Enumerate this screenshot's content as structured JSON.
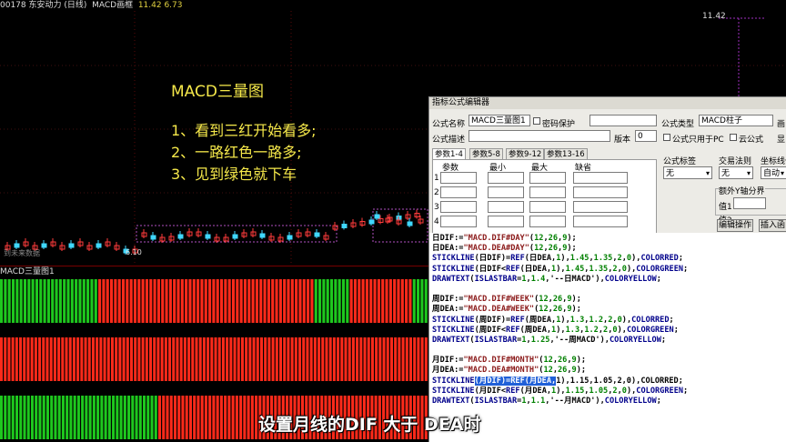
{
  "top_bar": {
    "stock": "00178 东安动力 (日线)",
    "indicator": "MACD画框",
    "values": "11.42   6.73"
  },
  "chart": {
    "high_label": "11.42",
    "low_label": "6.10",
    "bottom_left_text": "到未来数据"
  },
  "annotation": {
    "title": "MACD三量图",
    "lines": [
      "1、看到三红开始看多;",
      "2、一路红色一路多;",
      "3、见到绿色就下车"
    ]
  },
  "indicator_bar": {
    "label": "MACD三量图1"
  },
  "dialog": {
    "title": "指标公式编辑器",
    "formula_name_label": "公式名称",
    "formula_name_value": "MACD三量图1",
    "password_label": "密码保护",
    "formula_desc_label": "公式描述",
    "version_label": "版本",
    "version_value": "0",
    "formula_type_label": "公式类型",
    "formula_type_value": "MACD柱子",
    "draw_label": "画",
    "pc_only_label": "公式只用于PC",
    "cloud_label": "云公式",
    "show_label": "显",
    "tabs": [
      "参数1-4",
      "参数5-8",
      "参数9-12",
      "参数13-16"
    ],
    "param_headers": [
      "参数",
      "最小",
      "最大",
      "缺省"
    ],
    "param_rows": [
      "1",
      "2",
      "3",
      "4"
    ],
    "formula_tag_label": "公式标签",
    "formula_tag_value": "无",
    "trade_rule_label": "交易法则",
    "trade_rule_value": "无",
    "coord_label": "坐标线位",
    "coord_value": "自动",
    "extra_y_label": "额外Y轴分界",
    "value1_label": "值1",
    "value2_label": "值2",
    "edit_btn": "编辑操作",
    "insert_btn": "插入函"
  },
  "code_lines": [
    "日DIF:=\"MACD.DIF#DAY\"(12,26,9);",
    "日DEA:=\"MACD.DEA#DAY\"(12,26,9);",
    "STICKLINE(日DIF)=REF(日DEA,1),1.45,1.35,2,0),COLORRED;",
    "STICKLINE(日DIF<REF(日DEA,1),1.45,1.35,2,0),COLORGREEN;",
    "DRAWTEXT(ISLASTBAR=1,1.4,'--日MACD'),COLORYELLOW;",
    "",
    "周DIF:=\"MACD.DIF#WEEK\"(12,26,9);",
    "周DEA:=\"MACD.DEA#WEEK\"(12,26,9);",
    "STICKLINE(周DIF)=REF(周DEA,1),1.3,1.2,2,0),COLORRED;",
    "STICKLINE(周DIF<REF(周DEA,1),1.3,1.2,2,0),COLORGREEN;",
    "DRAWTEXT(ISLASTBAR=1,1.25,'--周MACD'),COLORYELLOW;",
    "",
    "月DIF:=\"MACD.DIF#MONTH\"(12,26,9);",
    "月DEA:=\"MACD.DEA#MONTH\"(12,26,9);",
    "STICKLINE(月DIF)=REF(月DEA,1),1.15,1.05,2,0),COLORRED;",
    "STICKLINE(月DIF<REF(月DEA,1),1.15,1.05,2,0),COLORGREEN;",
    "DRAWTEXT(ISLASTBAR=1,1.1,'--月MACD'),COLORYELLOW;"
  ],
  "highlight": "(月DIF)=REF(月DEA,",
  "subtitle": "设置月线的DIF 大于 DEA时",
  "bars": {
    "rows": [
      {
        "pattern": "GGGGGGGGGGGGGGGGGGGGGGGGGRRRRRRRRRRRRRRRRRRRRRRRRRRRRRRRRRRRRRRRRRRRRRRRRRRRRRRRGGGGGGGGGRRRRRRRRRRRRRRRRGGGG"
      },
      {
        "pattern": "RRRRRRRRRRRRRRRRRRRRRRRRRRRRRRRRRRRRRRRRRRRRRRRRRRRRRRRRRRRRRRRRRRRRRRRRRRRRRRRRRRRRRRRRRRRRRRRRRRRRRRRRRRRRRRRR"
      },
      {
        "pattern": "GGGGGGGGGGGGGGGGGGGGGGGGGGGGGGGGGGGGGGGGGRRRRRRRRRRRRRRRRRRRRRRRRRRRRRRRRRRRRRRRRRRRRRRRRRRRRRRRRRRRRRRRRRRRRRR"
      }
    ],
    "red": "#ff2a1a",
    "green": "#1ec81e"
  }
}
